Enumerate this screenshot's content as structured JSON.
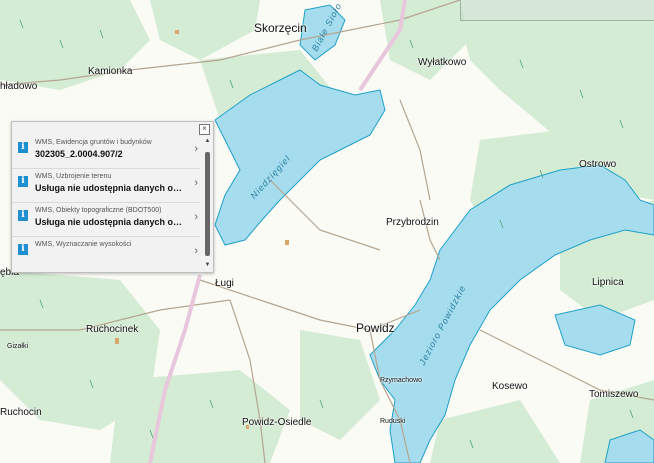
{
  "map": {
    "places": {
      "skorzecin": "Skorzęcin",
      "wylatkowo": "Wyłatkowo",
      "kamionka": "Kamionka",
      "hladowo": "hładowo",
      "ostrowo": "Ostrowo",
      "przybrodzin": "Przybrodzin",
      "lugi": "Ługi",
      "powidz": "Powidz",
      "lipnica": "Lipnica",
      "ruchocinek": "Ruchocinek",
      "kosewo": "Kosewo",
      "tomiszewo": "Tomiszewo",
      "ruchocin": "Ruchocin",
      "powidz_osiedle": "Powidz-Osiedle",
      "giebia": "ębia",
      "blizne": "Gizałki",
      "rzymachowo": "Rzymachowo",
      "ruduski": "Ruduski"
    },
    "lakes": {
      "biale_wioska": "Białe Sioło",
      "niedzigiel": "Niedzięgiel",
      "powidzkie": "Jezioro Powidzkie"
    }
  },
  "info_panel": {
    "close_glyph": "×",
    "arrow_glyph": "›",
    "items": [
      {
        "icon": "i",
        "label": "WMS, Ewidencja gruntów i budynków",
        "value": "302305_2.0004.907/2"
      },
      {
        "icon": "i",
        "label": "WMS, Uzbrojenie terenu",
        "value": "Usługa nie udostępnia danych op…"
      },
      {
        "icon": "i",
        "label": "WMS, Obiekty topograficzne (BDOT500)",
        "value": "Usługa nie udostępnia danych op…"
      },
      {
        "icon": "i",
        "label": "WMS, Wyznaczanie wysokości",
        "value": ""
      }
    ]
  },
  "colors": {
    "forest": "#d4ebd4",
    "water": "#a6ddee",
    "water_edge": "#1fa0c8",
    "road": "#b5a590",
    "boundary": "#e8c6dc",
    "accent": "#1e8fcf"
  }
}
